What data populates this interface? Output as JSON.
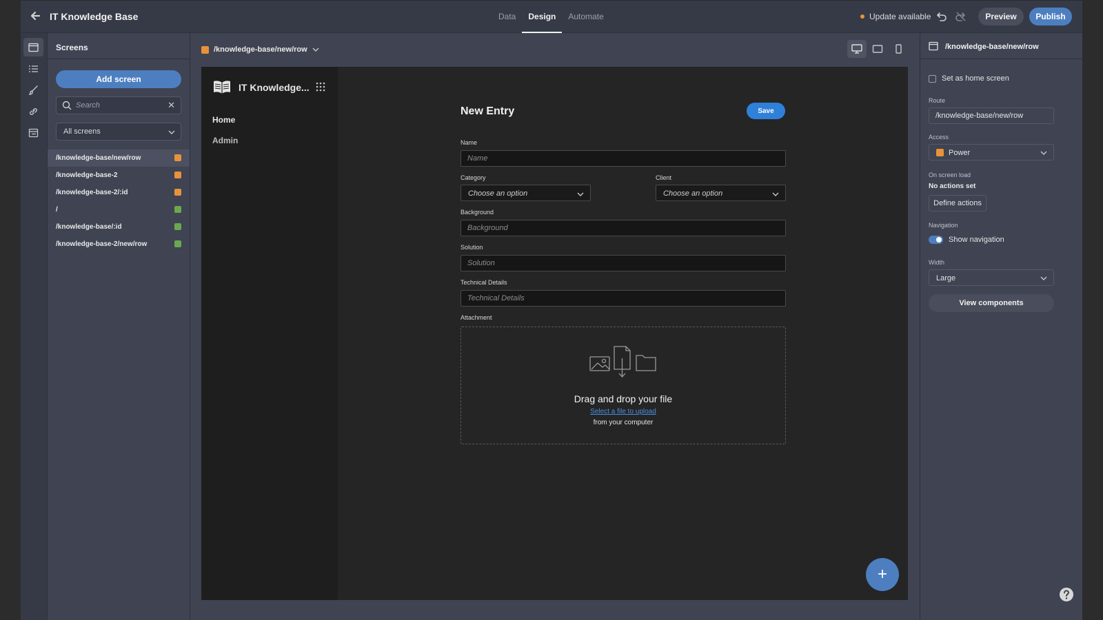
{
  "app": {
    "title": "IT Knowledge Base",
    "tabs": [
      "Data",
      "Design",
      "Automate"
    ],
    "active_tab": "Design",
    "update_text": "Update available",
    "preview_label": "Preview",
    "publish_label": "Publish"
  },
  "rail": {
    "items": [
      "screens-icon",
      "components-icon",
      "theme-brush-icon",
      "link-icon",
      "table-icon"
    ]
  },
  "screens_panel": {
    "title": "Screens",
    "add_label": "Add screen",
    "search_placeholder": "Search",
    "filter_value": "All screens",
    "items": [
      {
        "route": "/knowledge-base/new/row",
        "access_color": "#e8923c",
        "selected": true
      },
      {
        "route": "/knowledge-base-2",
        "access_color": "#e8923c",
        "selected": false
      },
      {
        "route": "/knowledge-base-2/:id",
        "access_color": "#e8923c",
        "selected": false
      },
      {
        "route": "/",
        "access_color": "#6aa84f",
        "selected": false
      },
      {
        "route": "/knowledge-base/:id",
        "access_color": "#6aa84f",
        "selected": false
      },
      {
        "route": "/knowledge-base-2/new/row",
        "access_color": "#6aa84f",
        "selected": false
      }
    ]
  },
  "canvas": {
    "route": "/knowledge-base/new/row",
    "devices": [
      "desktop-icon",
      "tablet-icon",
      "mobile-icon"
    ],
    "active_device": "desktop-icon"
  },
  "preview": {
    "app_title": "IT Knowledge...",
    "nav_links": [
      "Home",
      "Admin"
    ],
    "form_title": "New Entry",
    "save_label": "Save",
    "fields": {
      "name": {
        "label": "Name",
        "placeholder": "Name"
      },
      "category": {
        "label": "Category",
        "value": "Choose an option"
      },
      "client": {
        "label": "Client",
        "value": "Choose an option"
      },
      "background": {
        "label": "Background",
        "placeholder": "Background"
      },
      "solution": {
        "label": "Solution",
        "placeholder": "Solution"
      },
      "technical_details": {
        "label": "Technical Details",
        "placeholder": "Technical Details"
      },
      "attachment": {
        "label": "Attachment",
        "title": "Drag and drop your file",
        "link": "Select a file to upload",
        "sub": "from your computer"
      }
    },
    "fab_label": "+"
  },
  "settings": {
    "header": "/knowledge-base/new/row",
    "home_label": "Set as home screen",
    "home_checked": false,
    "route_label": "Route",
    "route_value": "/knowledge-base/new/row",
    "access_label": "Access",
    "access_value": "Power",
    "onload_label": "On screen load",
    "onload_value": "No actions set",
    "define_label": "Define actions",
    "navigation_label": "Navigation",
    "show_nav_label": "Show navigation",
    "show_nav_on": true,
    "width_label": "Width",
    "width_value": "Large",
    "view_components_label": "View components"
  },
  "colors": {
    "accent": "#4d7fc0",
    "save": "#2f80d9",
    "power": "#e8923c",
    "public": "#6aa84f"
  }
}
